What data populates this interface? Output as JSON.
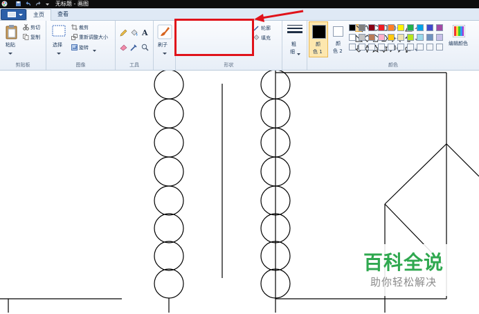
{
  "title_bar": {
    "title": "无标题 - 画图"
  },
  "tabs": {
    "home": "主页",
    "view": "查看"
  },
  "clipboard": {
    "paste": "粘贴",
    "cut": "剪切",
    "copy": "复制",
    "group_label": "剪贴板"
  },
  "image": {
    "select": "选择",
    "crop": "裁剪",
    "resize": "重新调整大小",
    "rotate": "旋转",
    "group_label": "图像"
  },
  "tools": {
    "group_label": "工具"
  },
  "brushes": {
    "label": "刷子"
  },
  "shapes": {
    "outline": "轮廓",
    "fill": "填充",
    "group_label": "形状"
  },
  "size": {
    "label_line1": "粗",
    "label_line2": "细"
  },
  "colors": {
    "color1_line1": "颜",
    "color1_line2": "色 1",
    "color2_line1": "颜",
    "color2_line2": "色 2",
    "edit_colors": "编辑颜色",
    "group_label": "颜色",
    "color1_value": "#000000",
    "color2_value": "#ffffff",
    "palette_row1": [
      "#000000",
      "#7f7f7f",
      "#880015",
      "#ed1c24",
      "#ff7f27",
      "#fff200",
      "#22b14c",
      "#00a2e8",
      "#3f48cc",
      "#a349a4"
    ],
    "palette_row2": [
      "#ffffff",
      "#c3c3c3",
      "#b97a57",
      "#ffaec9",
      "#ffc90e",
      "#efe4b0",
      "#b5e61d",
      "#99d9ea",
      "#7092be",
      "#c8bfe7"
    ]
  },
  "annotation": {
    "highlight_color": "#e0121a"
  },
  "watermark": {
    "title": "百科全说",
    "subtitle": "助你轻松解决"
  }
}
